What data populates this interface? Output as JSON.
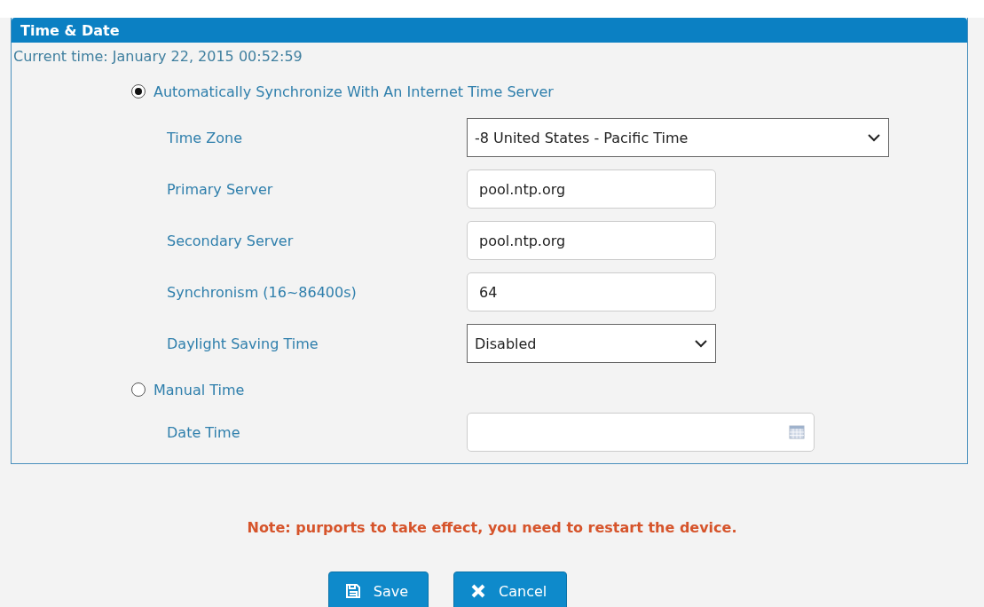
{
  "panel": {
    "title": "Time & Date",
    "current_time": "Current time: January 22, 2015 00:52:59"
  },
  "rows": [
    {
      "kind": "radio",
      "label": "Automatically Synchronize With An Internet Time Server",
      "selected": true
    },
    {
      "kind": "select",
      "label": "Time Zone",
      "value": "-8 United States - Pacific Time",
      "wide": true
    },
    {
      "kind": "text",
      "label": "Primary Server",
      "value": "pool.ntp.org"
    },
    {
      "kind": "text",
      "label": "Secondary Server",
      "value": "pool.ntp.org"
    },
    {
      "kind": "text",
      "label": "Synchronism (16~86400s)",
      "value": "64"
    },
    {
      "kind": "select",
      "label": "Daylight Saving Time",
      "value": "Disabled",
      "wide": false
    },
    {
      "kind": "radio",
      "label": "Manual Time",
      "selected": false
    },
    {
      "kind": "date",
      "label": "Date Time"
    }
  ],
  "note": "Note: purports to take effect, you need to restart the device.",
  "buttons": [
    {
      "kind": "save",
      "label": "Save"
    },
    {
      "kind": "cancel",
      "label": "Cancel"
    }
  ]
}
